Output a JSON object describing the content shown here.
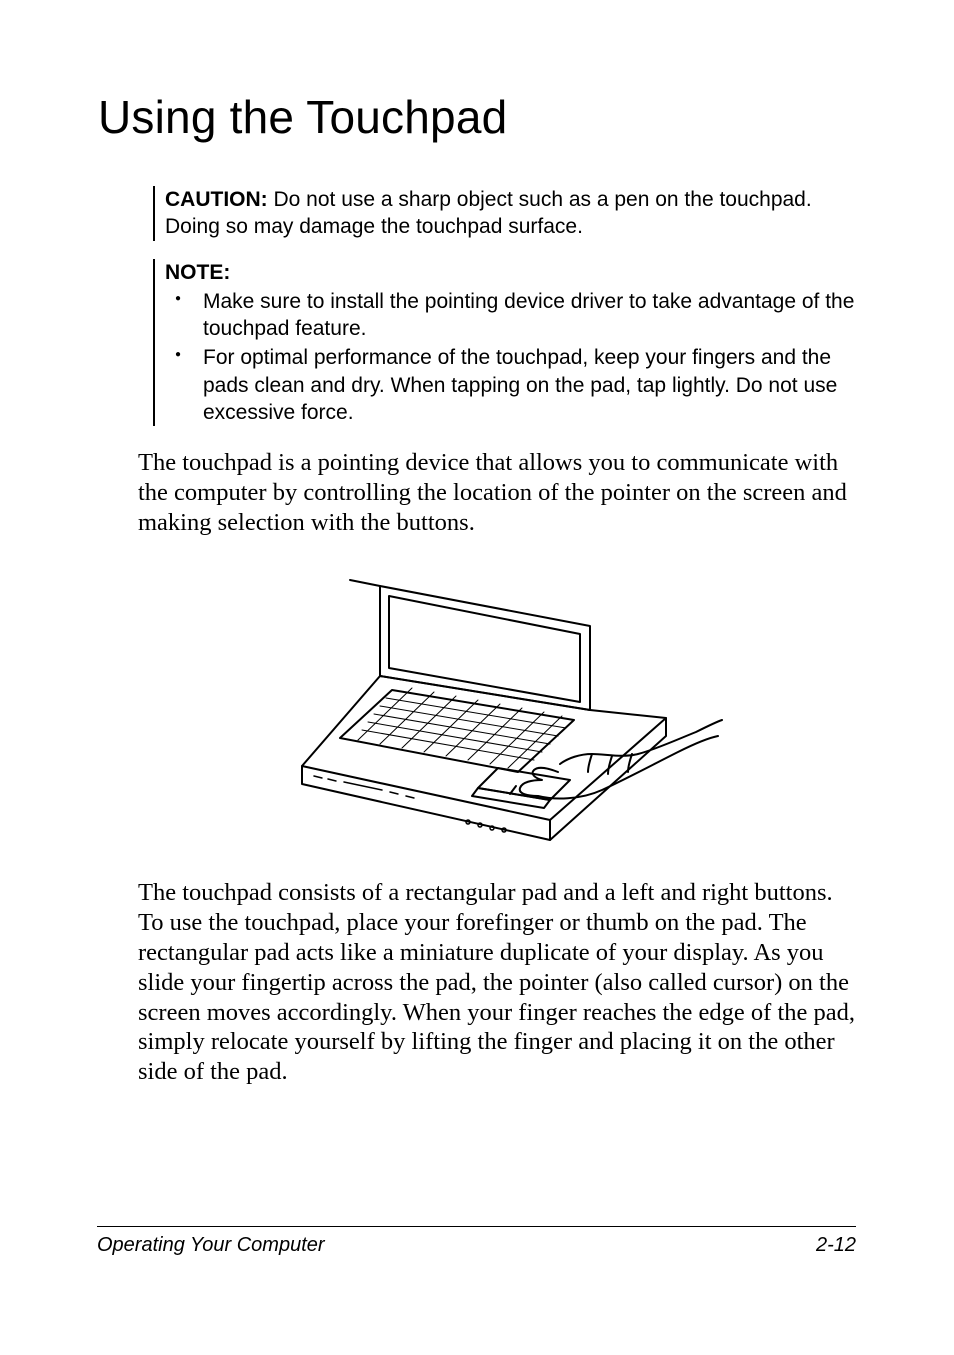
{
  "heading": "Using the Touchpad",
  "caution": {
    "label": "CAUTION:",
    "text": " Do not use a sharp object such as a pen on the touchpad. Doing so may damage the touchpad surface."
  },
  "note": {
    "label": "NOTE:",
    "items": [
      "Make sure to install the pointing device driver to take advantage of the touchpad feature.",
      "For optimal performance of the touchpad, keep your fingers and the pads clean and dry. When tapping on the pad, tap lightly. Do not use excessive force."
    ]
  },
  "para1": "The touchpad is a pointing device that allows you to communicate with the computer by controlling the location of the pointer on the screen and making selection with the buttons.",
  "para2": "The touchpad consists of a rectangular pad and a left and right buttons. To use the touchpad, place your forefinger or thumb on the pad. The rectangular pad acts like a miniature duplicate of your display. As you slide your fingertip across the pad, the pointer (also called cursor) on the screen moves accordingly. When your finger reaches the edge of the pad, simply relocate yourself by lifting the finger and placing it on the other side of the pad.",
  "footer": {
    "left": "Operating Your Computer",
    "right": "2-12"
  }
}
